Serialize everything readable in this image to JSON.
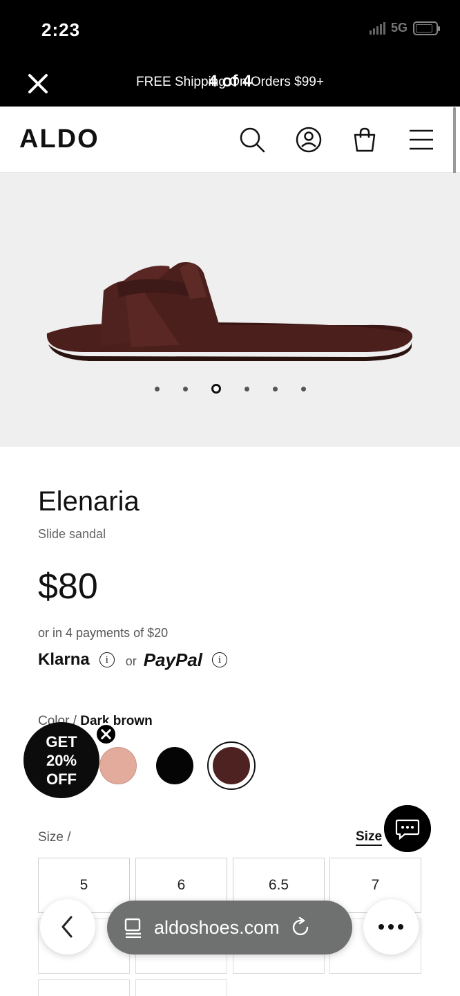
{
  "status_bar": {
    "time": "2:23",
    "network": "5G"
  },
  "promo_bar": {
    "text": "FREE Shipping On Orders $99+",
    "gallery_counter": "4 of 4"
  },
  "header": {
    "logo": "ALDO"
  },
  "gallery": {
    "total_images": 6,
    "active_index": 3
  },
  "product": {
    "name": "Elenaria",
    "type": "Slide sandal",
    "price": "$80",
    "installments": "or in 4 payments of $20",
    "klarna": "Klarna",
    "or": "or",
    "paypal": "PayPal"
  },
  "color": {
    "label": "Color /",
    "selected": "Dark brown",
    "swatches": [
      {
        "name": "Blush",
        "hex": "#e2ab9b"
      },
      {
        "name": "Black",
        "hex": "#050505"
      },
      {
        "name": "Dark brown",
        "hex": "#4d2220",
        "selected": true
      }
    ]
  },
  "promo_bubble": {
    "line1": "GET",
    "line2": "20%",
    "line3": "OFF"
  },
  "size": {
    "label": "Size /",
    "guide": "Size",
    "options": [
      "5",
      "6",
      "6.5",
      "7"
    ]
  },
  "browser": {
    "url": "aldoshoes.com"
  },
  "colors": {
    "black": "#000000",
    "image_bg": "#efefef",
    "sandal": "#4a1f1c"
  }
}
